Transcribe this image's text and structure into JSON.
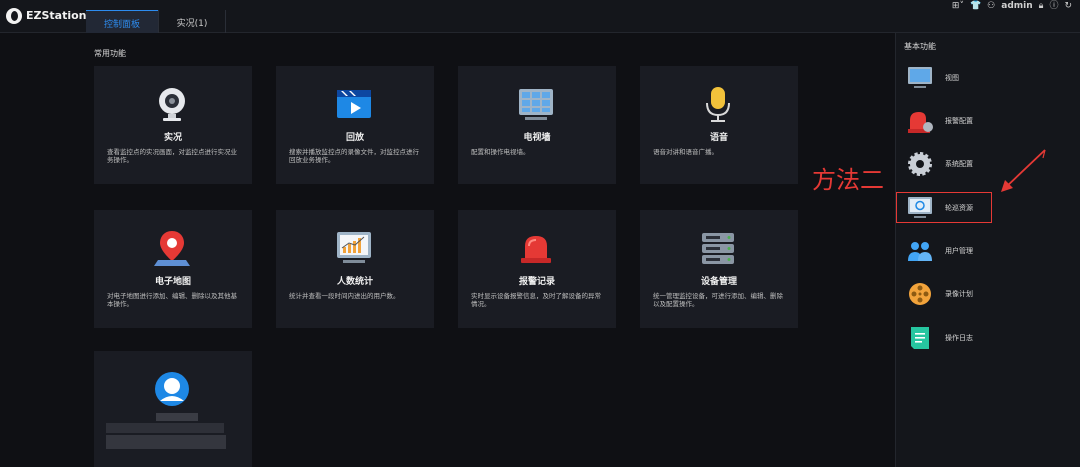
{
  "app": {
    "title": "EZStation"
  },
  "tabs": [
    {
      "label": "控制面板"
    },
    {
      "label": "实况(1)"
    }
  ],
  "top_right": {
    "user": "admin"
  },
  "main": {
    "section_title": "常用功能",
    "cards": [
      {
        "title": "实况",
        "desc": "查看监控点的实况画面，对监控点进行实况业务操作。",
        "icon": "camera-icon"
      },
      {
        "title": "回放",
        "desc": "搜索并播放监控点的录像文件，对监控点进行回放业务操作。",
        "icon": "playback-icon"
      },
      {
        "title": "电视墙",
        "desc": "配置和操作电视墙。",
        "icon": "tv-wall-icon"
      },
      {
        "title": "语音",
        "desc": "语音对讲和语音广播。",
        "icon": "microphone-icon"
      },
      {
        "title": "电子地图",
        "desc": "对电子地图进行添加、编辑、删除以及其他基本操作。",
        "icon": "map-pin-icon"
      },
      {
        "title": "人数统计",
        "desc": "统计并查看一段时间内进出的用户数。",
        "icon": "statistics-icon"
      },
      {
        "title": "报警记录",
        "desc": "实时显示设备报警信息，及时了解设备的异常情况。",
        "icon": "alarm-light-icon"
      },
      {
        "title": "设备管理",
        "desc": "统一管理监控设备，可进行添加、编辑、删除以及配置操作。",
        "icon": "server-icon"
      },
      {
        "title": "",
        "desc": "",
        "icon": "face-icon"
      }
    ]
  },
  "sidebar": {
    "title": "基本功能",
    "items": [
      {
        "label": "视图",
        "icon": "monitor-icon"
      },
      {
        "label": "报警配置",
        "icon": "alarm-config-icon"
      },
      {
        "label": "系统配置",
        "icon": "gear-icon"
      },
      {
        "label": "轮巡资源",
        "icon": "patrol-monitor-icon"
      },
      {
        "label": "用户管理",
        "icon": "users-icon"
      },
      {
        "label": "录像计划",
        "icon": "film-reel-icon"
      },
      {
        "label": "操作日志",
        "icon": "log-icon"
      }
    ]
  },
  "annotation": {
    "text": "方法二"
  }
}
